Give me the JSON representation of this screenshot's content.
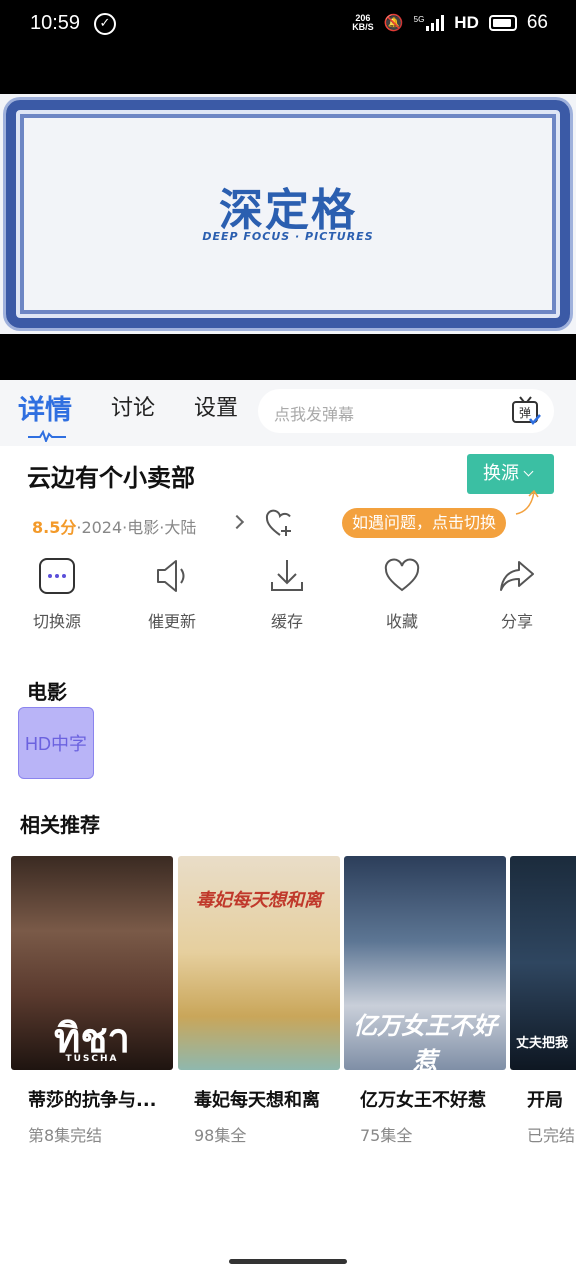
{
  "status_bar": {
    "time": "10:59",
    "net_speed_top": "206",
    "net_speed_bottom": "KB/S",
    "network": "5G",
    "hd": "HD",
    "battery": "66"
  },
  "video": {
    "logo_cn": "深定格",
    "logo_en": "DEEP FOCUS · PICTURES"
  },
  "tabs": [
    {
      "label": "详情"
    },
    {
      "label": "讨论"
    },
    {
      "label": "设置"
    }
  ],
  "danmu": {
    "placeholder": "点我发弹幕",
    "icon_text": "弹"
  },
  "title": "云边有个小卖部",
  "switch_source_label": "换源",
  "meta": {
    "score": "8.5分",
    "info": "·2024·电影·大陆"
  },
  "tip": "如遇问题，点击切换",
  "actions": [
    {
      "label": "切换源",
      "icon": "more-icon"
    },
    {
      "label": "催更新",
      "icon": "speaker-icon"
    },
    {
      "label": "缓存",
      "icon": "download-icon"
    },
    {
      "label": "收藏",
      "icon": "heart-icon"
    },
    {
      "label": "分享",
      "icon": "share-icon"
    }
  ],
  "episodes_section": {
    "title": "电影",
    "items": [
      "HD中字"
    ]
  },
  "recommend_section": {
    "title": "相关推荐",
    "items": [
      {
        "title": "蒂莎的抗争与...",
        "sub": "第8集完结",
        "poster_text": "ทิชา",
        "poster_sub": "TUSCHA"
      },
      {
        "title": "毒妃每天想和离",
        "sub": "98集全",
        "poster_text": "毒妃每天想和离"
      },
      {
        "title": "亿万女王不好惹",
        "sub": "75集全",
        "poster_text": "亿万女王不好惹"
      },
      {
        "title": "开局",
        "sub": "已完结",
        "poster_text": "丈夫把我"
      }
    ]
  }
}
